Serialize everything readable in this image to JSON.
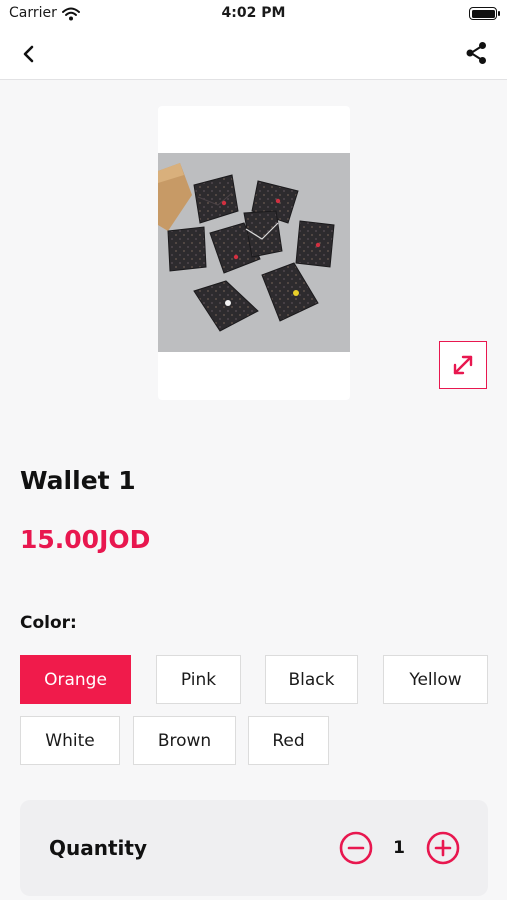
{
  "status_bar": {
    "carrier": "Carrier",
    "time": "4:02 PM"
  },
  "nav": {
    "back_icon": "chevron-left-icon",
    "share_icon": "share-icon"
  },
  "product": {
    "title": "Wallet 1",
    "price": "15.00JOD",
    "image_description": "wallets-photo",
    "expand_icon": "expand-icon"
  },
  "color": {
    "label": "Color:",
    "options": [
      "Orange",
      "Pink",
      "Black",
      "Yellow",
      "White",
      "Brown",
      "Red"
    ],
    "selected": "Orange"
  },
  "quantity": {
    "label": "Quantity",
    "value": "1",
    "decrease_icon": "minus-circle-icon",
    "increase_icon": "plus-circle-icon"
  },
  "colors": {
    "accent": "#e8174f",
    "background": "#f7f7f8"
  }
}
